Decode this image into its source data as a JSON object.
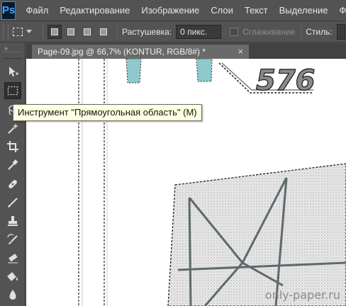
{
  "app": {
    "logo_text": "Ps",
    "accent": "#3fa7ff"
  },
  "menu": {
    "items": [
      "Файл",
      "Редактирование",
      "Изображение",
      "Слои",
      "Текст",
      "Выделение",
      "Фил"
    ]
  },
  "options_bar": {
    "feather_label": "Растушевка:",
    "feather_value": "0 пикс.",
    "antialias_label": "Сглаживание",
    "style_label": "Стиль:"
  },
  "toolbar": {
    "collapse_glyph": "»",
    "tools": [
      "move-tool",
      "marquee-tool",
      "lasso-tool",
      "magic-wand-tool",
      "crop-tool",
      "eyedropper-tool",
      "healing-brush-tool",
      "brush-tool",
      "clone-stamp-tool",
      "history-brush-tool",
      "eraser-tool",
      "paint-bucket-tool",
      "blur-tool"
    ],
    "active_tool": "marquee-tool"
  },
  "document_tab": {
    "title": "Page-09.jpg @ 66,7% (KONTUR, RGB/8#) *",
    "close_glyph": "×"
  },
  "tooltip": {
    "text": "Инструмент \"Прямоугольная область\" (M)"
  },
  "canvas": {
    "page_number": "576",
    "watermark": "only-paper.ru"
  }
}
